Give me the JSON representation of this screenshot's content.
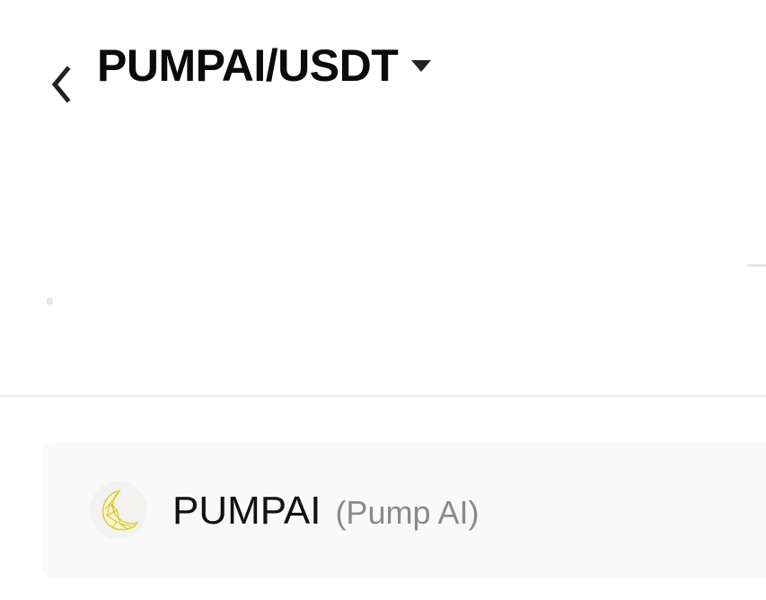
{
  "header": {
    "back_icon": "chevron-left-icon",
    "pair_title": "PUMPAI/USDT",
    "dropdown_icon": "caret-down-icon"
  },
  "token_card": {
    "logo_icon": "crescent-moon-logo",
    "symbol": "PUMPAI",
    "name": "(Pump AI)"
  },
  "colors": {
    "background": "#ffffff",
    "title_text": "#0b0b0b",
    "secondary_text": "#8a8a8a",
    "card_background": "#f9f9f9",
    "divider": "#ececec",
    "logo_gold": "#e2cf3f"
  }
}
